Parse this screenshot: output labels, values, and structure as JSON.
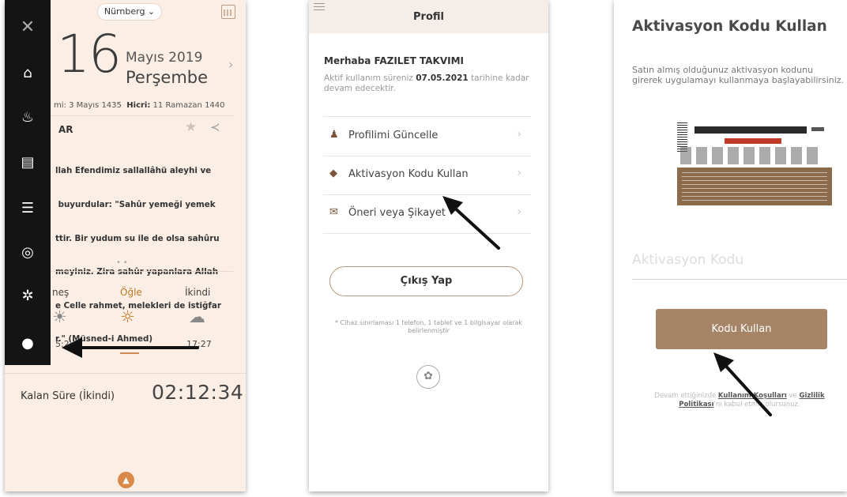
{
  "screen1": {
    "city": "Nürnberg",
    "day": "16",
    "month_year": "Mayıs 2019",
    "weekday": "Perşembe",
    "hijri_prefix": "mi: 3 Mayıs 1435",
    "hijri_label": "Hicri:",
    "hijri_value": "11 Ramazan 1440",
    "card_title": "AR",
    "hadith_lines": [
      "llah Efendimiz sallallâhü aleyhi ve",
      " buyurdular: \"Sahûr yemeği yemek",
      "ttir. Bir yudum su ile de olsa sahûru",
      "meyiniz. Zira sahûr yapanlara Allah",
      "e Celle rahmet, melekleri de istiğfar",
      "r.\" (Müsned-i Ahmed)"
    ],
    "prayers": [
      {
        "name": "neş",
        "time": "5:2"
      },
      {
        "name": "Öğle",
        "time": ""
      },
      {
        "name": "İkindi",
        "time": "17:27"
      }
    ],
    "remaining_label": "Kalan Süre (İkindi)",
    "remaining_value": "02:12:34"
  },
  "screen2": {
    "title": "Profil",
    "greeting": "Merhaba FAZILET TAKVIMI",
    "sub_pre": "Aktif kullanım süreniz ",
    "sub_date": "07.05.2021",
    "sub_post": " tarihine kadar devam edecektir.",
    "menu": [
      {
        "label": "Profilimi Güncelle"
      },
      {
        "label": "Aktivasyon Kodu Kullan"
      },
      {
        "label": "Öneri veya Şikayet"
      }
    ],
    "logout": "Çıkış Yap",
    "note": "* Cihaz sınırlaması 1 telefon, 1 tablet ve 1 bilgisayar olarak belirlenmiştir"
  },
  "screen3": {
    "title": "Aktivasyon Kodu Kullan",
    "description": "Satın almış olduğunuz aktivasyon kodunu girerek uygulamayı kullanmaya başlayabilirsiniz.",
    "input_placeholder": "Aktivasyon Kodu",
    "button": "Kodu Kullan",
    "terms_pre": "Devam ettiğinizde ",
    "terms_link1": "Kullanım Koşulları",
    "terms_mid": " ve ",
    "terms_link2": "Gizlilik Politikası",
    "terms_post": "'nı kabul etmiş olursunuz."
  },
  "icons": {
    "sidebar": [
      "close-icon",
      "home-icon",
      "mosque-icon",
      "book-icon",
      "list-icon",
      "compass-icon",
      "settings-icon",
      "user-icon"
    ],
    "profile_menu": [
      "user-edit-icon",
      "tag-icon",
      "envelope-icon"
    ]
  },
  "colors": {
    "accent": "#c0771f",
    "brown": "#a68466",
    "sidebar": "#141414",
    "cream": "#fbeee4"
  }
}
